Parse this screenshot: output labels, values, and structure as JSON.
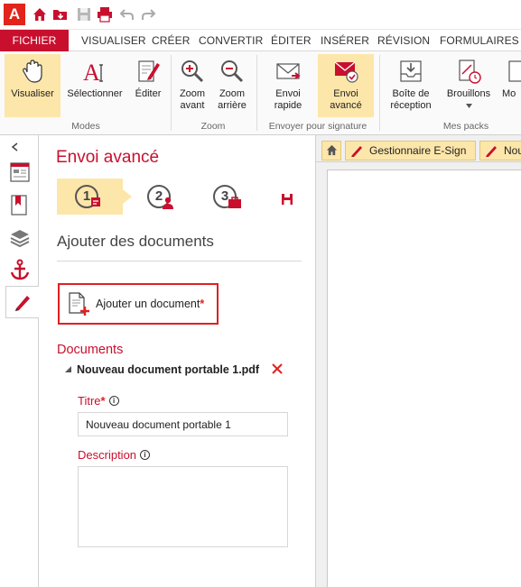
{
  "app": {
    "logo_letter": "A"
  },
  "quick_access": [
    {
      "name": "home-icon"
    },
    {
      "name": "open-folder-icon"
    },
    {
      "name": "save-icon"
    },
    {
      "name": "print-icon"
    },
    {
      "name": "undo-icon"
    },
    {
      "name": "redo-icon"
    }
  ],
  "tabs": [
    "FICHIER",
    "VISUALISER",
    "CRÉER",
    "CONVERTIR",
    "ÉDITER",
    "INSÉRER",
    "RÉVISION",
    "FORMULAIRES"
  ],
  "ribbon": {
    "groups": {
      "modes": "Modes",
      "zoom": "Zoom",
      "send": "Envoyer pour signature",
      "packs": "Mes packs"
    },
    "buttons": {
      "view": "Visualiser",
      "select": "Sélectionner",
      "edit": "Éditer",
      "zoom_in_1": "Zoom",
      "zoom_in_2": "avant",
      "zoom_out_1": "Zoom",
      "zoom_out_2": "arrière",
      "quick_send_1": "Envoi",
      "quick_send_2": "rapide",
      "adv_send_1": "Envoi",
      "adv_send_2": "avancé",
      "inbox_1": "Boîte de",
      "inbox_2": "réception",
      "drafts": "Brouillons",
      "more": "Mo"
    }
  },
  "panel": {
    "title": "Envoi avancé",
    "steps": [
      "1",
      "2",
      "3"
    ],
    "subtitle": "Ajouter des documents",
    "add_document": "Ajouter un document",
    "required_mark": "*",
    "documents_title": "Documents",
    "document_name": "Nouveau document portable 1.pdf",
    "title_label": "Titre",
    "title_value": "Nouveau document portable 1",
    "description_label": "Description",
    "info_glyph": "i"
  },
  "doc_tabs": {
    "home": "home-icon",
    "tab1": "Gestionnaire E-Sign",
    "tab2": "Nou"
  },
  "colors": {
    "brand_red": "#c8102e",
    "active_yellow": "#fde6a9",
    "error_red": "#e02020"
  }
}
